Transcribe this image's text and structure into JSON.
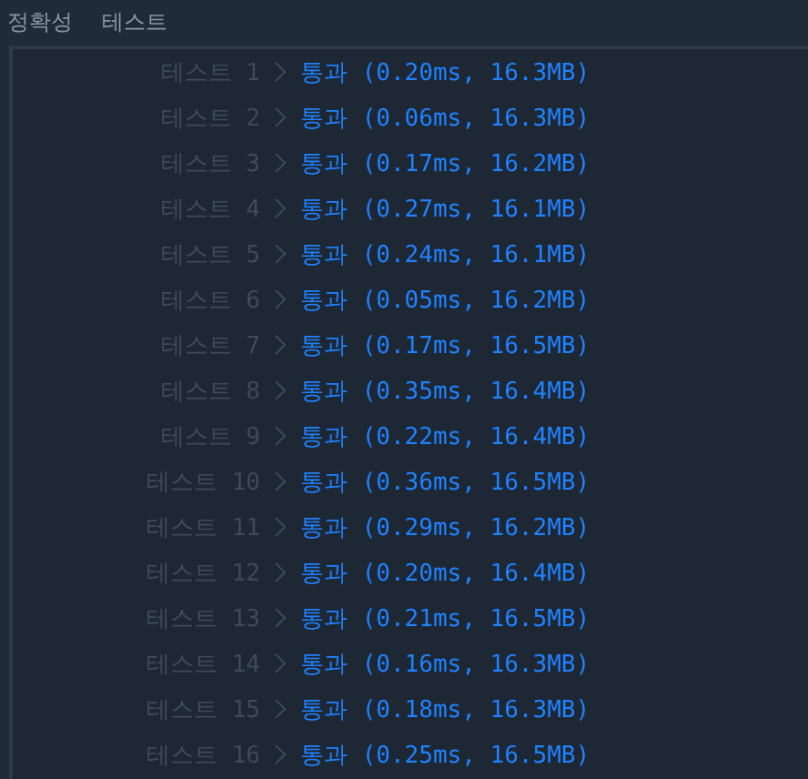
{
  "header": [
    "정확성",
    "테스트"
  ],
  "rows": [
    {
      "label": "테스트 1",
      "result": "통과 (0.20ms, 16.3MB)"
    },
    {
      "label": "테스트 2",
      "result": "통과 (0.06ms, 16.3MB)"
    },
    {
      "label": "테스트 3",
      "result": "통과 (0.17ms, 16.2MB)"
    },
    {
      "label": "테스트 4",
      "result": "통과 (0.27ms, 16.1MB)"
    },
    {
      "label": "테스트 5",
      "result": "통과 (0.24ms, 16.1MB)"
    },
    {
      "label": "테스트 6",
      "result": "통과 (0.05ms, 16.2MB)"
    },
    {
      "label": "테스트 7",
      "result": "통과 (0.17ms, 16.5MB)"
    },
    {
      "label": "테스트 8",
      "result": "통과 (0.35ms, 16.4MB)"
    },
    {
      "label": "테스트 9",
      "result": "통과 (0.22ms, 16.4MB)"
    },
    {
      "label": "테스트 10",
      "result": "통과 (0.36ms, 16.5MB)"
    },
    {
      "label": "테스트 11",
      "result": "통과 (0.29ms, 16.2MB)"
    },
    {
      "label": "테스트 12",
      "result": "통과 (0.20ms, 16.4MB)"
    },
    {
      "label": "테스트 13",
      "result": "통과 (0.21ms, 16.5MB)"
    },
    {
      "label": "테스트 14",
      "result": "통과 (0.16ms, 16.3MB)"
    },
    {
      "label": "테스트 15",
      "result": "통과 (0.18ms, 16.3MB)"
    },
    {
      "label": "테스트 16",
      "result": "통과 (0.25ms, 16.5MB)"
    }
  ]
}
